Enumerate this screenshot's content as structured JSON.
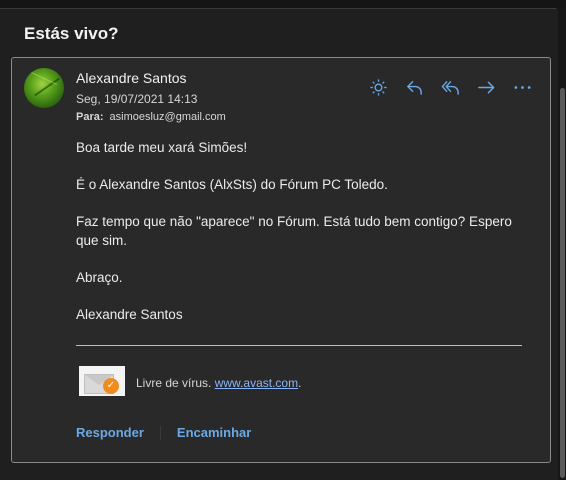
{
  "subject": "Estás vivo?",
  "message": {
    "sender": "Alexandre Santos",
    "date": "Seg, 19/07/2021 14:13",
    "to_label": "Para:",
    "to": "asimoesluz@gmail.com",
    "body": [
      "Boa tarde meu xará Simões!",
      "É o Alexandre Santos (AlxSts) do Fórum PC Toledo.",
      "Faz tempo que não \"aparece\" no Fórum. Está tudo bem contigo? Espero que sim.",
      "Abraço.",
      "Alexandre Santos"
    ],
    "signature": {
      "text": "Livre de vírus.",
      "link": "www.avast.com",
      "suffix": "."
    }
  },
  "actions": [
    {
      "name": "brightness-icon"
    },
    {
      "name": "reply-icon"
    },
    {
      "name": "reply-all-icon"
    },
    {
      "name": "forward-icon"
    },
    {
      "name": "more-icon"
    }
  ],
  "footer": {
    "reply": "Responder",
    "forward": "Encaminhar"
  },
  "colors": {
    "background": "#1f1f1f",
    "card": "#292929",
    "accent": "#6aa9e6",
    "link": "#8ab4f8"
  }
}
